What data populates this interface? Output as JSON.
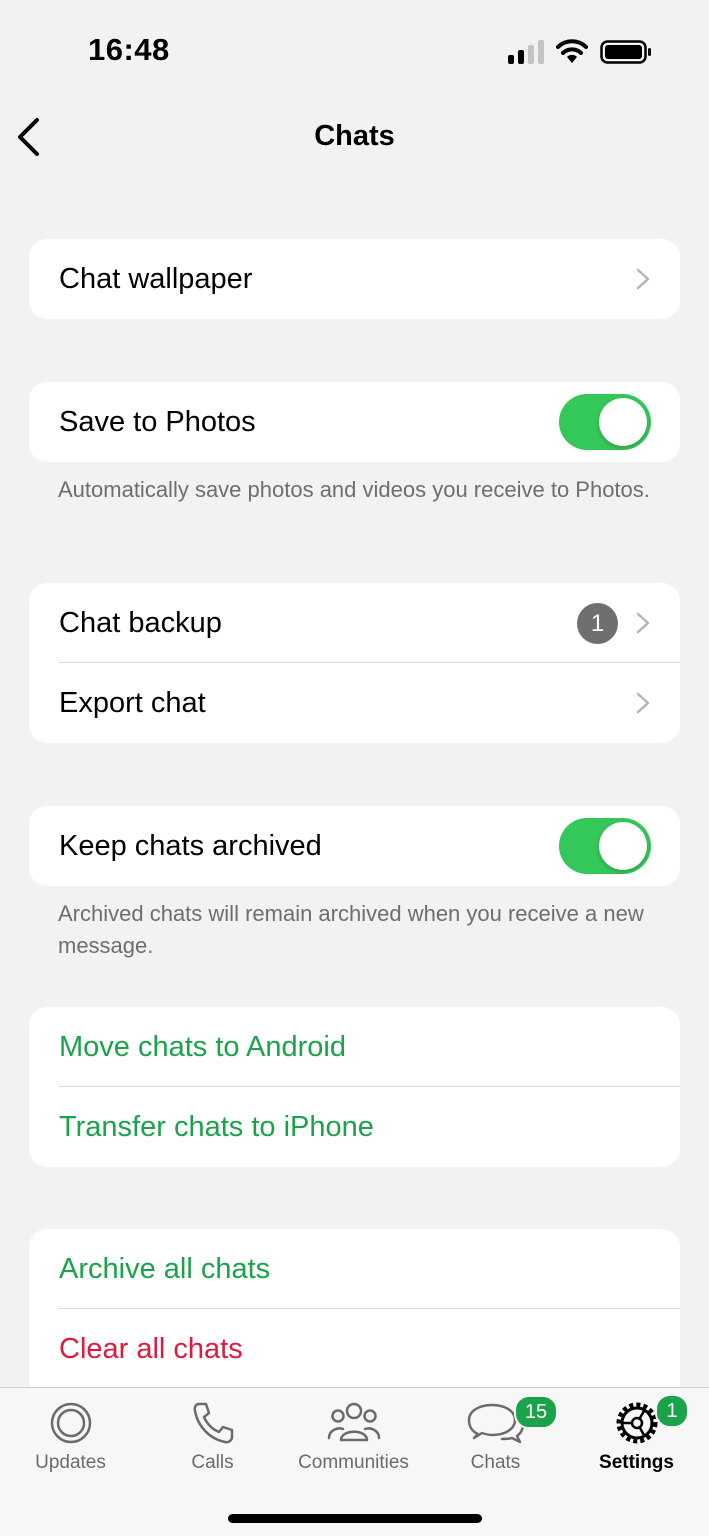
{
  "status_bar": {
    "time": "16:48"
  },
  "nav": {
    "title": "Chats"
  },
  "groups": {
    "wallpaper": {
      "label": "Chat wallpaper"
    },
    "save_photos": {
      "label": "Save to Photos",
      "enabled": true,
      "footnote": "Automatically save photos and videos you receive to Photos."
    },
    "backup": {
      "chat_backup_label": "Chat backup",
      "chat_backup_badge": "1",
      "export_label": "Export chat"
    },
    "archived": {
      "label": "Keep chats archived",
      "enabled": true,
      "footnote": "Archived chats will remain archived when you receive a new message."
    },
    "transfer": {
      "move_android_label": "Move chats to Android",
      "transfer_iphone_label": "Transfer chats to iPhone"
    },
    "danger": {
      "archive_all_label": "Archive all chats",
      "clear_all_label": "Clear all chats"
    }
  },
  "tab_bar": {
    "tabs": [
      {
        "label": "Updates",
        "icon": "updates-icon"
      },
      {
        "label": "Calls",
        "icon": "phone-icon"
      },
      {
        "label": "Communities",
        "icon": "communities-icon"
      },
      {
        "label": "Chats",
        "icon": "chats-icon",
        "badge": "15"
      },
      {
        "label": "Settings",
        "icon": "settings-gear-icon",
        "badge": "1",
        "active": true
      }
    ]
  },
  "colors": {
    "accent_green": "#1aa34a",
    "toggle_green": "#34c759",
    "destructive_red": "#e0193f"
  }
}
